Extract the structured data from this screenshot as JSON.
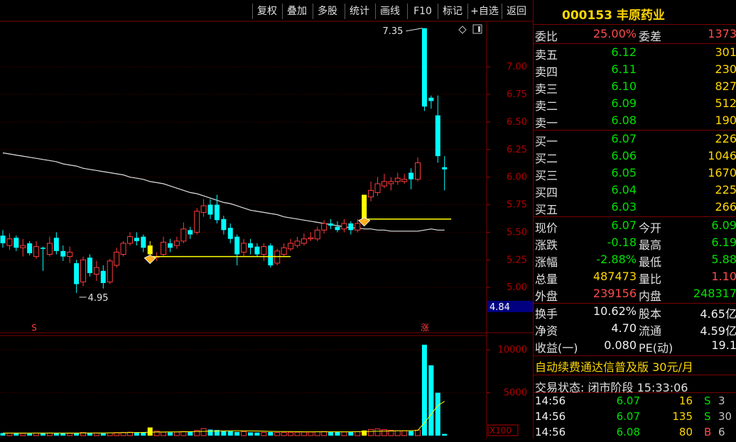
{
  "toolbar": {
    "items": [
      "复权",
      "叠加",
      "多股",
      "统计",
      "画线",
      "F10",
      "标记",
      "+自选",
      "返回"
    ]
  },
  "stock": {
    "code": "000153",
    "name": "丰原药业"
  },
  "quote": {
    "weibi_label": "委比",
    "weibi_value": "25.00%",
    "weicha_label": "委差",
    "weicha_value": "1373",
    "asks": [
      {
        "label": "卖五",
        "price": "6.12",
        "vol": "301"
      },
      {
        "label": "卖四",
        "price": "6.11",
        "vol": "230"
      },
      {
        "label": "卖三",
        "price": "6.10",
        "vol": "827"
      },
      {
        "label": "卖二",
        "price": "6.09",
        "vol": "512"
      },
      {
        "label": "卖一",
        "price": "6.08",
        "vol": "190"
      }
    ],
    "bids": [
      {
        "label": "买一",
        "price": "6.07",
        "vol": "226"
      },
      {
        "label": "买二",
        "price": "6.06",
        "vol": "1046"
      },
      {
        "label": "买三",
        "price": "6.05",
        "vol": "1670"
      },
      {
        "label": "买四",
        "price": "6.04",
        "vol": "225"
      },
      {
        "label": "买五",
        "price": "6.03",
        "vol": "266"
      }
    ],
    "stats": [
      {
        "l1": "现价",
        "v1": "6.07",
        "c1": "dn",
        "l2": "今开",
        "v2": "6.09",
        "c2": "dn"
      },
      {
        "l1": "涨跌",
        "v1": "-0.18",
        "c1": "dn",
        "l2": "最高",
        "v2": "6.19",
        "c2": "dn"
      },
      {
        "l1": "涨幅",
        "v1": "-2.88%",
        "c1": "dn",
        "l2": "最低",
        "v2": "5.88",
        "c2": "dn"
      },
      {
        "l1": "总量",
        "v1": "487473",
        "c1": "ye",
        "l2": "量比",
        "v2": "1.10",
        "c2": "up"
      },
      {
        "l1": "外盘",
        "v1": "239156",
        "c1": "up",
        "l2": "内盘",
        "v2": "248317",
        "c2": "dn"
      }
    ],
    "extra": [
      {
        "l1": "换手",
        "v1": "10.62%",
        "l2": "股本",
        "v2": "4.65亿"
      },
      {
        "l1": "净资",
        "v1": "4.70",
        "l2": "流通",
        "v2": "4.59亿"
      },
      {
        "l1": "收益(一)",
        "v1": "0.080",
        "l2": "PE(动)",
        "v2": "19.1"
      }
    ],
    "ad_text": "自动续费通达信普及版",
    "ad_price": "30元/月",
    "status_label": "交易状态:",
    "status_value": "闭市阶段",
    "status_time": "15:33:06",
    "ticks": [
      {
        "time": "14:56",
        "price": "6.07",
        "vol": "16",
        "bs": "S",
        "n": "3"
      },
      {
        "time": "14:56",
        "price": "6.07",
        "vol": "135",
        "bs": "S",
        "n": "30"
      },
      {
        "time": "14:56",
        "price": "6.08",
        "vol": "80",
        "bs": "B",
        "n": "6"
      }
    ]
  },
  "chart_data": {
    "type": "candlestick",
    "price_axis": {
      "ticks": [
        "7.00",
        "6.75",
        "6.50",
        "6.25",
        "6.00",
        "5.75",
        "5.50",
        "5.25",
        "5.00"
      ],
      "range": [
        4.84,
        7.4
      ],
      "current_label": "4.84"
    },
    "annotations": {
      "high": "7.35",
      "low": "4.95",
      "marker_s": "S",
      "marker_zhang": "涨"
    },
    "volume_axis": {
      "ticks": [
        "10000",
        "5000"
      ],
      "multiplier": "X100",
      "range": [
        0,
        11500
      ]
    },
    "colors": {
      "up": "#ff3c3c",
      "down": "#00ffff",
      "highlight": "#ffff00",
      "ma": "#e0e0e0"
    },
    "candles": [
      [
        5.47,
        5.4,
        5.52,
        5.36
      ],
      [
        5.38,
        5.44,
        5.49,
        5.34
      ],
      [
        5.45,
        5.36,
        5.47,
        5.33
      ],
      [
        5.36,
        5.38,
        5.44,
        5.28
      ],
      [
        5.4,
        5.31,
        5.42,
        5.29
      ],
      [
        5.28,
        5.37,
        5.42,
        5.26
      ],
      [
        5.36,
        5.35,
        5.37,
        5.15
      ],
      [
        5.3,
        5.4,
        5.46,
        5.28
      ],
      [
        5.45,
        5.33,
        5.5,
        5.3
      ],
      [
        5.33,
        5.28,
        5.38,
        5.24
      ],
      [
        5.28,
        5.32,
        5.37,
        5.22
      ],
      [
        5.22,
        5.03,
        5.25,
        4.95
      ],
      [
        5.05,
        5.25,
        5.28,
        5.01
      ],
      [
        5.27,
        5.13,
        5.3,
        5.1
      ],
      [
        5.12,
        5.18,
        5.24,
        5.06
      ],
      [
        5.15,
        5.04,
        5.2,
        4.99
      ],
      [
        5.05,
        5.24,
        5.26,
        5.03
      ],
      [
        5.2,
        5.32,
        5.36,
        5.18
      ],
      [
        5.3,
        5.4,
        5.42,
        5.28
      ],
      [
        5.4,
        5.46,
        5.5,
        5.38
      ],
      [
        5.45,
        5.42,
        5.5,
        5.38
      ],
      [
        5.46,
        5.36,
        5.48,
        5.32
      ],
      [
        5.38,
        5.3,
        5.42,
        5.28
      ],
      [
        5.28,
        5.28,
        5.32,
        5.24
      ],
      [
        5.3,
        5.41,
        5.46,
        5.28
      ],
      [
        5.4,
        5.36,
        5.44,
        5.32
      ],
      [
        5.38,
        5.42,
        5.46,
        5.35
      ],
      [
        5.42,
        5.53,
        5.59,
        5.4
      ],
      [
        5.52,
        5.48,
        5.55,
        5.44
      ],
      [
        5.5,
        5.69,
        5.72,
        5.48
      ],
      [
        5.68,
        5.74,
        5.8,
        5.64
      ],
      [
        5.75,
        5.66,
        5.8,
        5.62
      ],
      [
        5.75,
        5.61,
        5.84,
        5.58
      ],
      [
        5.62,
        5.52,
        5.65,
        5.48
      ],
      [
        5.54,
        5.44,
        5.58,
        5.4
      ],
      [
        5.46,
        5.3,
        5.48,
        5.2
      ],
      [
        5.32,
        5.4,
        5.44,
        5.28
      ],
      [
        5.4,
        5.36,
        5.44,
        5.3
      ],
      [
        5.37,
        5.3,
        5.4,
        5.28
      ],
      [
        5.3,
        5.37,
        5.4,
        5.24
      ],
      [
        5.38,
        5.2,
        5.4,
        5.18
      ],
      [
        5.22,
        5.33,
        5.35,
        5.2
      ],
      [
        5.3,
        5.36,
        5.4,
        5.28
      ],
      [
        5.35,
        5.4,
        5.44,
        5.33
      ],
      [
        5.38,
        5.42,
        5.46,
        5.36
      ],
      [
        5.4,
        5.44,
        5.49,
        5.38
      ],
      [
        5.44,
        5.45,
        5.5,
        5.42
      ],
      [
        5.44,
        5.52,
        5.55,
        5.42
      ],
      [
        5.52,
        5.58,
        5.61,
        5.49
      ],
      [
        5.58,
        5.56,
        5.62,
        5.53
      ],
      [
        5.55,
        5.52,
        5.6,
        5.5
      ],
      [
        5.53,
        5.58,
        5.62,
        5.5
      ],
      [
        5.58,
        5.52,
        5.6,
        5.48
      ],
      [
        5.52,
        5.58,
        5.62,
        5.5
      ],
      [
        5.62,
        5.84,
        5.84,
        5.62
      ],
      [
        5.82,
        5.88,
        5.96,
        5.78
      ],
      [
        5.86,
        5.94,
        6.0,
        5.83
      ],
      [
        5.92,
        5.96,
        6.03,
        5.9
      ],
      [
        5.94,
        5.96,
        6.0,
        5.88
      ],
      [
        5.96,
        5.99,
        6.04,
        5.93
      ],
      [
        5.96,
        5.98,
        6.03,
        5.94
      ],
      [
        6.04,
        5.98,
        6.08,
        5.89
      ],
      [
        5.98,
        6.13,
        6.18,
        5.96
      ],
      [
        7.35,
        6.64,
        7.35,
        6.6
      ],
      [
        6.72,
        6.69,
        6.74,
        6.62
      ],
      [
        6.56,
        6.19,
        6.74,
        6.13
      ],
      [
        6.09,
        6.07,
        6.19,
        5.88
      ]
    ],
    "highlighted_candles": [
      22,
      54
    ],
    "ma": [
      6.22,
      6.21,
      6.2,
      6.19,
      6.18,
      6.17,
      6.16,
      6.15,
      6.14,
      6.12,
      6.11,
      6.1,
      6.08,
      6.07,
      6.06,
      6.05,
      6.04,
      6.03,
      6.02,
      6.0,
      5.99,
      5.98,
      5.96,
      5.95,
      5.94,
      5.92,
      5.9,
      5.88,
      5.86,
      5.85,
      5.83,
      5.81,
      5.79,
      5.77,
      5.76,
      5.74,
      5.72,
      5.7,
      5.69,
      5.68,
      5.67,
      5.66,
      5.64,
      5.63,
      5.62,
      5.61,
      5.6,
      5.59,
      5.58,
      5.57,
      5.56,
      5.55,
      5.54,
      5.54,
      5.53,
      5.53,
      5.52,
      5.52,
      5.51,
      5.51,
      5.51,
      5.51,
      5.51,
      5.52,
      5.53,
      5.52,
      5.52
    ],
    "volume": [
      300,
      280,
      310,
      260,
      240,
      290,
      320,
      300,
      280,
      270,
      260,
      330,
      360,
      300,
      290,
      270,
      330,
      360,
      380,
      400,
      360,
      340,
      950,
      520,
      400,
      380,
      420,
      480,
      460,
      600,
      820,
      700,
      650,
      560,
      520,
      420,
      460,
      380,
      360,
      380,
      420,
      360,
      380,
      390,
      400,
      420,
      420,
      460,
      480,
      450,
      420,
      430,
      420,
      450,
      600,
      720,
      780,
      700,
      620,
      580,
      560,
      520,
      640,
      10600,
      8200,
      5000,
      200
    ],
    "volume_ma": [
      300,
      300,
      300,
      300,
      300,
      300,
      300,
      300,
      300,
      300,
      300,
      300,
      310,
      310,
      310,
      310,
      320,
      330,
      340,
      350,
      360,
      370,
      400,
      410,
      420,
      430,
      440,
      450,
      460,
      480,
      500,
      520,
      540,
      550,
      560,
      560,
      560,
      550,
      540,
      520,
      500,
      490,
      480,
      470,
      460,
      450,
      450,
      450,
      450,
      450,
      450,
      450,
      450,
      460,
      470,
      490,
      510,
      530,
      540,
      560,
      570,
      580,
      600,
      1500,
      2500,
      3500,
      4000
    ]
  }
}
